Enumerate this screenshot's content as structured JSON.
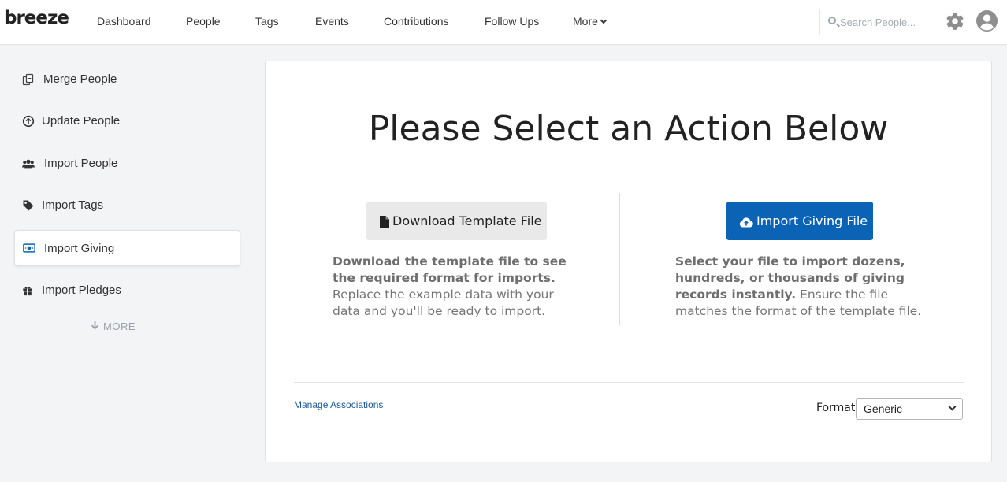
{
  "app": {
    "logo": "breeze"
  },
  "nav": {
    "items": [
      {
        "label": "Dashboard"
      },
      {
        "label": "People"
      },
      {
        "label": "Tags"
      },
      {
        "label": "Events"
      },
      {
        "label": "Contributions"
      },
      {
        "label": "Follow Ups"
      },
      {
        "label": "More"
      }
    ],
    "search_placeholder": "Search People..."
  },
  "sidebar": {
    "items": [
      {
        "label": "Merge People",
        "icon": "merge-icon"
      },
      {
        "label": "Update People",
        "icon": "upload-circle-icon"
      },
      {
        "label": "Import People",
        "icon": "users-icon"
      },
      {
        "label": "Import Tags",
        "icon": "tag-icon"
      },
      {
        "label": "Import Giving",
        "icon": "money-icon",
        "active": true
      },
      {
        "label": "Import Pledges",
        "icon": "gift-icon"
      }
    ],
    "more_label": "MORE"
  },
  "main": {
    "title": "Please Select an Action Below",
    "download": {
      "button_label": "Download Template File",
      "desc_bold": "Download the template file to see the required format for imports.",
      "desc_rest": " Replace the example data with your data and you'll be ready to import."
    },
    "import": {
      "button_label": "Import Giving File",
      "desc_bold": "Select your file to import dozens, hundreds, or thousands of giving records instantly.",
      "desc_rest": " Ensure the file matches the format of the template file."
    },
    "manage_link": "Manage Associations",
    "format_label": "Format:",
    "format_value": "Generic"
  },
  "colors": {
    "primary": "#0b63b6",
    "background": "#f3f4f6",
    "link": "#1a5a94"
  }
}
